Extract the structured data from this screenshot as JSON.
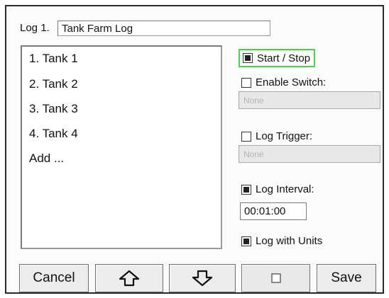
{
  "header": {
    "log_label": "Log 1.",
    "log_name": "Tank Farm Log"
  },
  "list": {
    "items": [
      "1. Tank 1",
      "2. Tank 2",
      "3. Tank 3",
      "4. Tank 4",
      "Add ..."
    ]
  },
  "options": {
    "start_stop": {
      "label": "Start / Stop",
      "checked": true
    },
    "enable_switch": {
      "label": "Enable Switch:",
      "checked": false,
      "value": "None"
    },
    "log_trigger": {
      "label": "Log Trigger:",
      "checked": false,
      "value": "None"
    },
    "log_interval": {
      "label": "Log Interval:",
      "checked": true,
      "value": "00:01:00"
    },
    "log_with_units": {
      "label": "Log with Units",
      "checked": true
    }
  },
  "buttons": {
    "cancel": "Cancel",
    "up_icon": "arrow-up-outline",
    "down_icon": "arrow-down-outline",
    "toggle_icon": "square-outline",
    "save": "Save"
  },
  "colors": {
    "focus_border": "#47d647"
  }
}
